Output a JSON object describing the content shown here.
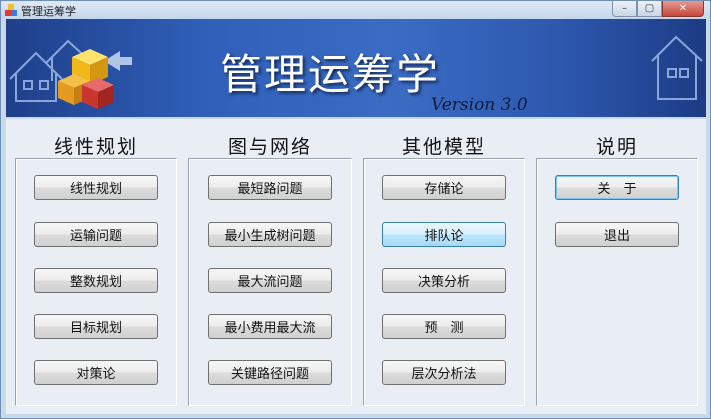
{
  "window": {
    "title": "管理运筹学",
    "controls": [
      "–",
      "▢",
      "✕"
    ]
  },
  "banner": {
    "title": "管理运筹学",
    "version": "Version 3.0"
  },
  "panels": [
    {
      "title": "线性规划",
      "buttons": [
        "线性规划",
        "运输问题",
        "整数规划",
        "目标规划",
        "对策论"
      ]
    },
    {
      "title": "图与网络",
      "buttons": [
        "最短路问题",
        "最小生成树问题",
        "最大流问题",
        "最小费用最大流",
        "关键路径问题"
      ]
    },
    {
      "title": "其他模型",
      "buttons": [
        "存储论",
        "排队论",
        "决策分析",
        "预　测",
        "层次分析法"
      ]
    },
    {
      "title": "说明",
      "buttons": [
        "关　于",
        "退出"
      ]
    }
  ],
  "colors": {
    "banner": "#2f5fb8",
    "hover_button": "#bee6fd"
  }
}
